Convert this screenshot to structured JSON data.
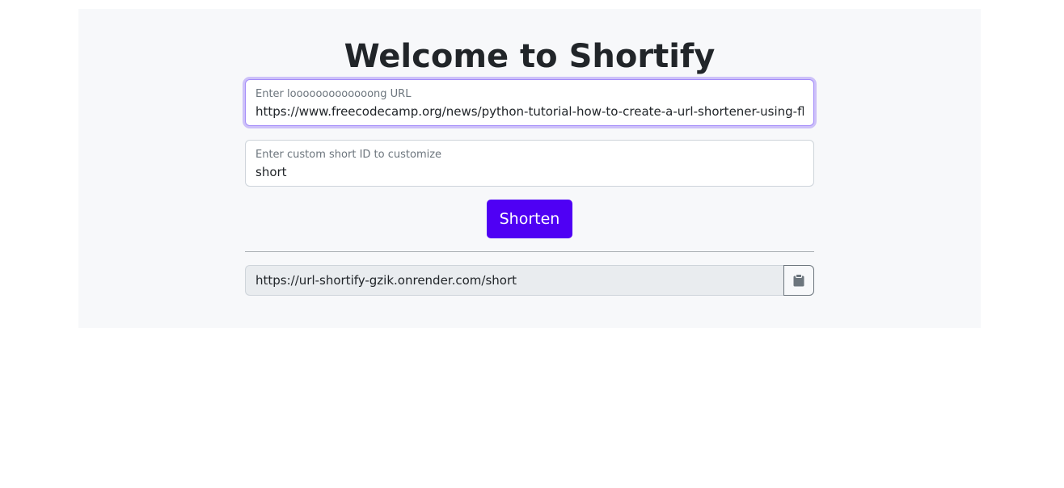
{
  "page": {
    "title": "Welcome to Shortify"
  },
  "url_field": {
    "label": "Enter looooooooooooong URL",
    "value": "https://www.freecodecamp.org/news/python-tutorial-how-to-create-a-url-shortener-using-fla"
  },
  "custom_id_field": {
    "label": "Enter custom short ID to customize",
    "value": "short"
  },
  "shorten_button": {
    "label": "Shorten"
  },
  "result": {
    "short_url": "https://url-shortify-gzik.onrender.com/short",
    "copy_icon": "clipboard-icon"
  },
  "colors": {
    "accent": "#4f00f4",
    "focus_ring": "#a48cf9",
    "panel_bg": "#f7f8fa",
    "readonly_bg": "#e9ecef"
  }
}
